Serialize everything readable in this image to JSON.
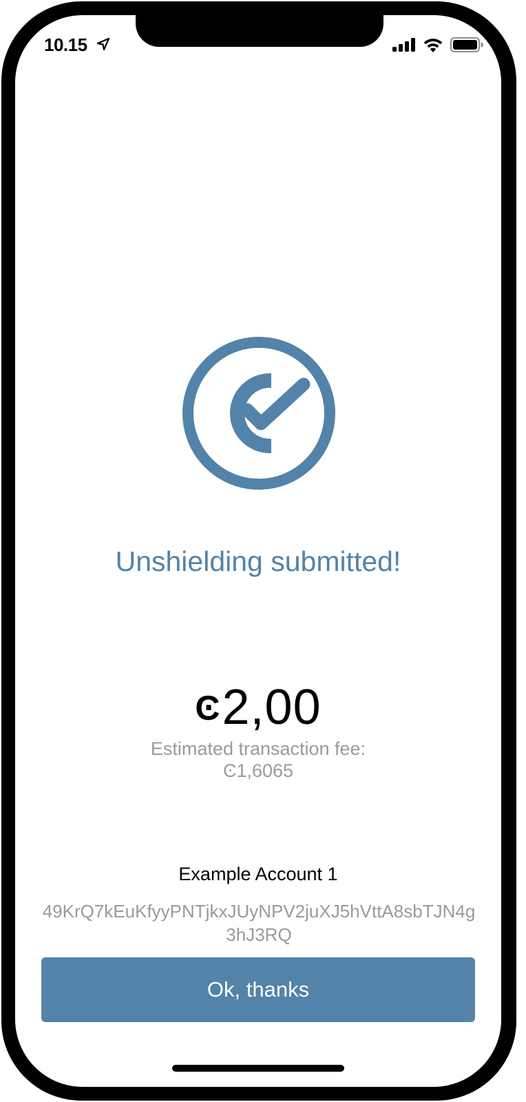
{
  "status_bar": {
    "time": "10.15",
    "icons": [
      "location-arrow-icon",
      "cellular-signal-icon",
      "wifi-icon",
      "battery-icon"
    ]
  },
  "result": {
    "headline": "Unshielding submitted!",
    "icon": "shield-checkmark-icon",
    "amount_symbol": "Ͼ",
    "amount_value": "2,00",
    "fee_label": "Estimated transaction fee:",
    "fee_value": "Ͼ1,6065"
  },
  "account": {
    "name": "Example Account 1",
    "address": "49KrQ7kEuKfyyPNTjkxJUyNPV2juXJ5hVttA8sbTJN4g3hJ3RQ"
  },
  "actions": {
    "ok_label": "Ok, thanks"
  },
  "colors": {
    "accent": "#5383a8",
    "secondary_text": "#9a9a9a",
    "frame": "#000000"
  }
}
